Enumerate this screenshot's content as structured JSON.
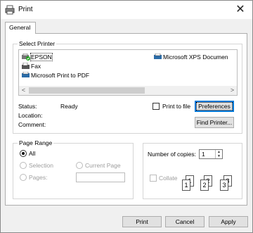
{
  "window": {
    "title": "Print",
    "close_glyph": "✕"
  },
  "tabs": [
    {
      "label": "General"
    }
  ],
  "select_printer": {
    "legend": "Select Printer",
    "printers": [
      {
        "name": "EPSON",
        "icon": "printer-default-icon",
        "selected": true
      },
      {
        "name": "Fax",
        "icon": "fax-icon"
      },
      {
        "name": "Microsoft Print to PDF",
        "icon": "printer-icon"
      },
      {
        "name": "Microsoft XPS Documen",
        "icon": "printer-icon"
      }
    ],
    "scroll_left": "<",
    "scroll_right": ">",
    "status_label": "Status:",
    "status_value": "Ready",
    "location_label": "Location:",
    "comment_label": "Comment:",
    "print_to_file": "Print to file",
    "preferences": "Preferences",
    "find_printer": "Find Printer..."
  },
  "page_range": {
    "legend": "Page Range",
    "all": "All",
    "selection": "Selection",
    "current_page": "Current Page",
    "pages": "Pages:",
    "selected": "All"
  },
  "copies": {
    "label": "Number of copies:",
    "value": "1",
    "collate": "Collate",
    "collate_pages": [
      "1",
      "1",
      "2",
      "2",
      "3",
      "3"
    ]
  },
  "footer": {
    "print": "Print",
    "cancel": "Cancel",
    "apply": "Apply"
  },
  "colors": {
    "accent": "#0078d7",
    "dialog_bg": "#f0f0f0",
    "panel_bg": "#ffffff"
  }
}
